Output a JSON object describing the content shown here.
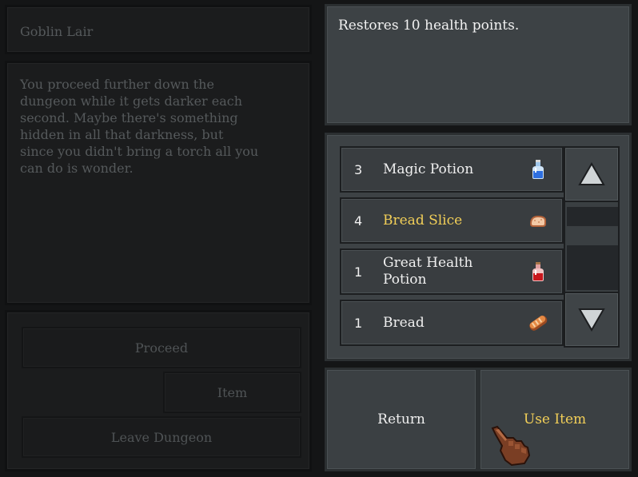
{
  "location": {
    "title": "Goblin Lair"
  },
  "narrative": {
    "lines": [
      "You proceed further down the",
      "dungeon while it gets darker each",
      "second. Maybe there's something",
      "hidden in all that darkness, but",
      "since you didn't bring a torch all you",
      "can do is wonder."
    ]
  },
  "actions": {
    "proceed_label": "Proceed",
    "item_label": "Item",
    "leave_label": "Leave Dungeon"
  },
  "item_description": "Restores 10 health points.",
  "inventory": {
    "items": [
      {
        "qty": "3",
        "name": "Magic Potion",
        "icon": "blue-potion-icon"
      },
      {
        "qty": "4",
        "name": "Bread Slice",
        "icon": "bread-slice-icon",
        "selected": true
      },
      {
        "qty": "1",
        "name_line1": "Great Health",
        "name_line2": "Potion",
        "icon": "red-potion-icon"
      },
      {
        "qty": "1",
        "name": "Bread",
        "icon": "bread-icon"
      }
    ]
  },
  "bottom": {
    "return_label": "Return",
    "use_label": "Use Item"
  },
  "colors": {
    "selected_text": "#f2cf58",
    "disabled_text": "#55595b",
    "panel_grey": "#3d4245"
  }
}
